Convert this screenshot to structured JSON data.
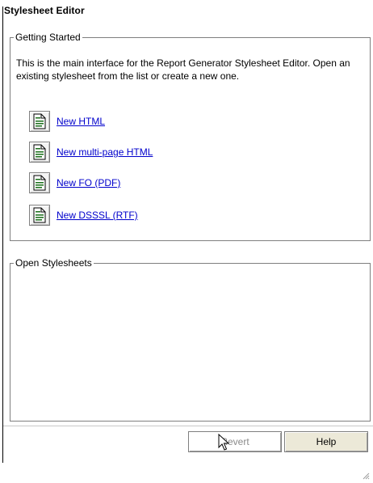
{
  "page_title": "Stylesheet Editor",
  "getting_started": {
    "legend": "Getting Started",
    "intro": "This is the main interface for the Report Generator Stylesheet Editor.  Open an existing stylesheet from the list or create a new one.",
    "actions": [
      {
        "label": "New HTML",
        "icon": "html-document-icon"
      },
      {
        "label": "New multi-page HTML",
        "icon": "html-document-icon"
      },
      {
        "label": "New FO (PDF)",
        "icon": "fo-document-icon"
      },
      {
        "label": "New DSSSL (RTF)",
        "icon": "dsssl-document-icon"
      }
    ]
  },
  "open_stylesheets": {
    "legend": "Open Stylesheets",
    "items": []
  },
  "buttons": {
    "revert_label": "Revert",
    "help_label": "Help"
  },
  "colors": {
    "link": "#0000cc",
    "border": "#7f7f7f",
    "button_face": "#ece9d8"
  }
}
